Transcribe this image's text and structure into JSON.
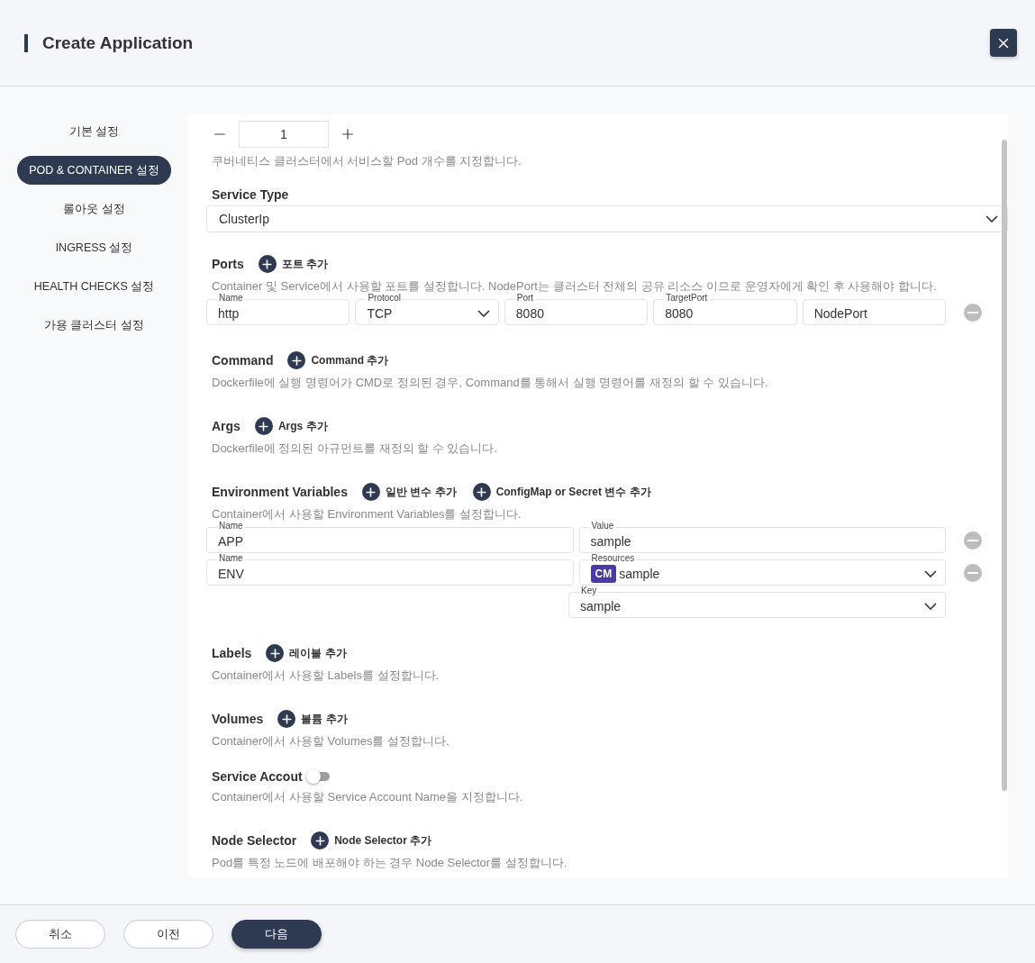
{
  "header": {
    "title": "Create Application"
  },
  "sidebar": {
    "items": [
      {
        "label": "기본 설정",
        "selected": false
      },
      {
        "label": "POD & CONTAINER 설정",
        "selected": true
      },
      {
        "label": "롤아웃 설정",
        "selected": false
      },
      {
        "label": "INGRESS 설정",
        "selected": false
      },
      {
        "label": "HEALTH CHECKS 설정",
        "selected": false
      },
      {
        "label": "가용 클러스터 설정",
        "selected": false
      }
    ]
  },
  "replicas": {
    "value": "1",
    "description": "쿠버네티스 클러스터에서 서비스할 Pod 개수를 지정합니다."
  },
  "service_type": {
    "label": "Service Type",
    "value": "ClusterIp"
  },
  "sections": [
    {
      "kind": "ports",
      "label": "Ports",
      "add_buttons": [
        "포트 추가"
      ],
      "description": "Container 및 Service에서 사용할 포트를 설정합니다. NodePort는 클러스터 전체의 공유 리소스 이므로 운영자에게 확인 후 사용해야 합니다.",
      "fields": [
        {
          "kind": "text",
          "label": "Name",
          "value": "http"
        },
        {
          "kind": "select",
          "label": "Protocol",
          "value": "TCP"
        },
        {
          "kind": "text",
          "label": "Port",
          "value": "8080"
        },
        {
          "kind": "text",
          "label": "TargetPort",
          "value": "8080"
        },
        {
          "kind": "text",
          "value": "NodePort"
        }
      ]
    },
    {
      "kind": "add",
      "label": "Command",
      "add_buttons": [
        "Command 추가"
      ],
      "description": "Dockerfile에 실행 명령어가 CMD로 정의된 경우, Command를 통해서 실행 명령어를 재정의 할 수 있습니다."
    },
    {
      "kind": "add",
      "label": "Args",
      "add_buttons": [
        "Args 추가"
      ],
      "description": "Dockerfile에 정의된 아규먼트를 재정의 할 수 있습니다."
    },
    {
      "kind": "env",
      "label": "Environment Variables",
      "add_buttons": [
        "일반 변수 추가",
        "ConfigMap or Secret 변수 추가"
      ],
      "description": "Container에서 사용할 Environment Variables를 설정합니다.",
      "rows": [
        {
          "name": {
            "label": "Name",
            "value": "APP"
          },
          "value": {
            "kind": "text",
            "label": "Value",
            "value": "sample"
          }
        },
        {
          "name": {
            "label": "Name",
            "value": "ENV"
          },
          "value": {
            "kind": "resource",
            "label": "Resources",
            "badge": "CM",
            "value": "sample"
          },
          "key": {
            "label": "Key",
            "value": "sample"
          }
        }
      ]
    },
    {
      "kind": "add",
      "label": "Labels",
      "add_buttons": [
        "레이블 추가"
      ],
      "description": "Container에서 사용할 Labels를 설정합니다."
    },
    {
      "kind": "add",
      "label": "Volumes",
      "add_buttons": [
        "볼륨 추가"
      ],
      "description": "Container에서 사용할 Volumes를 설정합니다."
    },
    {
      "kind": "toggle",
      "label": "Service Accout",
      "on": false,
      "description": "Container에서 사용할 Service Account Name을 지정합니다."
    },
    {
      "kind": "add",
      "label": "Node Selector",
      "add_buttons": [
        "Node Selector 추가"
      ],
      "description": "Pod를 특정 노드에 배포해야 하는 경우 Node Selector를 설정합니다."
    }
  ],
  "footer": {
    "buttons": [
      {
        "label": "취소",
        "kind": "outline"
      },
      {
        "label": "이전",
        "kind": "outline"
      },
      {
        "label": "다음",
        "kind": "primary"
      }
    ]
  }
}
